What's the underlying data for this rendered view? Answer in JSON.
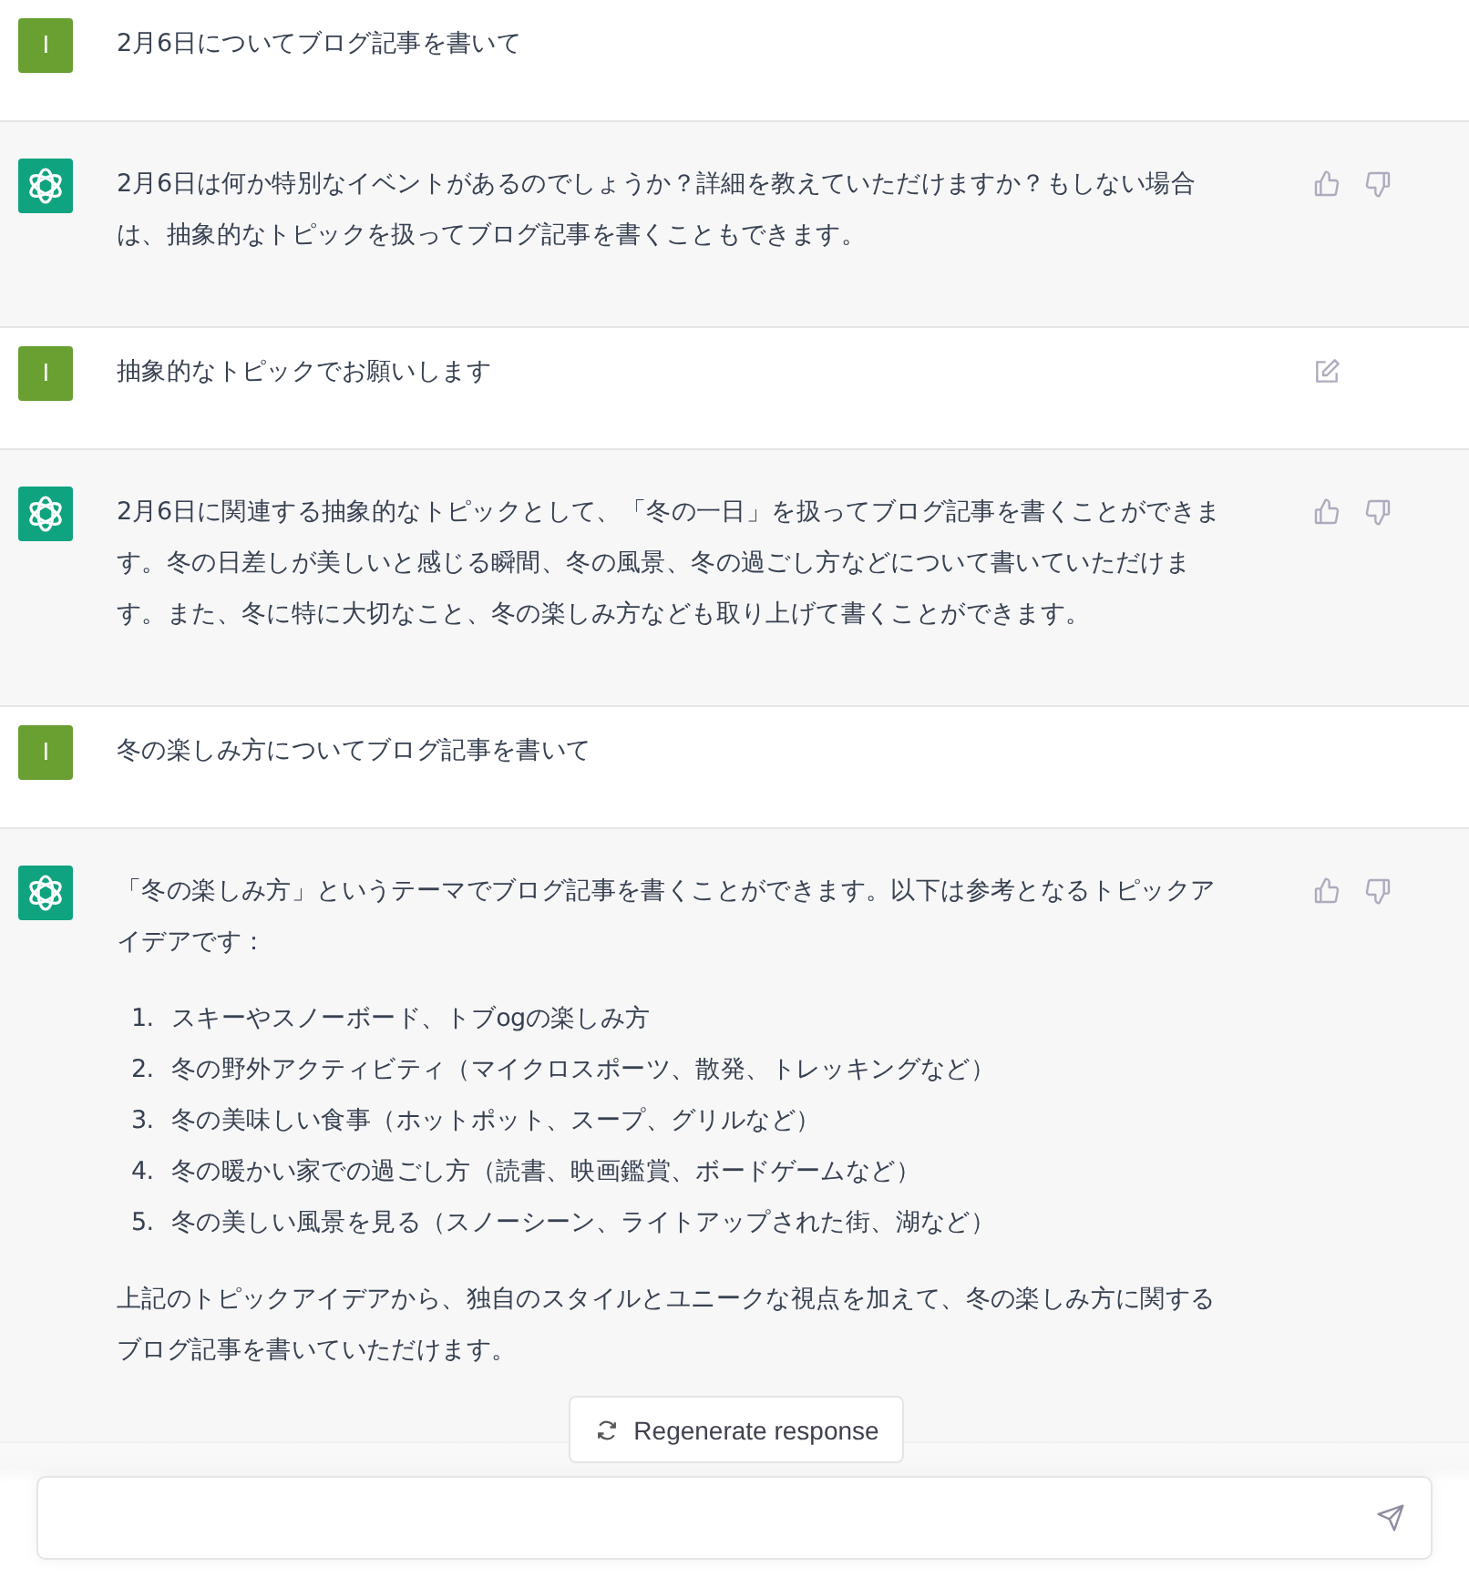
{
  "messages": [
    {
      "kind": "user",
      "avatar": "I",
      "feedback": false,
      "editable": false,
      "blocks": [
        {
          "kind": "paragraph",
          "text": "2月6日についてブログ記事を書いて"
        }
      ]
    },
    {
      "kind": "assistant",
      "feedback": true,
      "editable": false,
      "blocks": [
        {
          "kind": "paragraph",
          "text": "2月6日は何か特別なイベントがあるのでしょうか？詳細を教えていただけますか？もしない場合は、抽象的なトピックを扱ってブログ記事を書くこともできます。"
        }
      ]
    },
    {
      "kind": "user",
      "avatar": "I",
      "feedback": false,
      "editable": true,
      "blocks": [
        {
          "kind": "paragraph",
          "text": "抽象的なトピックでお願いします"
        }
      ]
    },
    {
      "kind": "assistant",
      "feedback": true,
      "editable": false,
      "blocks": [
        {
          "kind": "paragraph",
          "text": "2月6日に関連する抽象的なトピックとして、「冬の一日」を扱ってブログ記事を書くことができます。冬の日差しが美しいと感じる瞬間、冬の風景、冬の過ごし方などについて書いていただけます。また、冬に特に大切なこと、冬の楽しみ方なども取り上げて書くことができます。"
        }
      ]
    },
    {
      "kind": "user",
      "avatar": "I",
      "feedback": false,
      "editable": false,
      "blocks": [
        {
          "kind": "paragraph",
          "text": "冬の楽しみ方についてブログ記事を書いて"
        }
      ]
    },
    {
      "kind": "assistant",
      "feedback": true,
      "editable": false,
      "blocks": [
        {
          "kind": "paragraph",
          "text": "「冬の楽しみ方」というテーマでブログ記事を書くことができます。以下は参考となるトピックアイデアです："
        },
        {
          "kind": "list",
          "items": [
            {
              "number": "1.",
              "text": "スキーやスノーボード、トブogの楽しみ方"
            },
            {
              "number": "2.",
              "text": "冬の野外アクティビティ（マイクロスポーツ、散発、トレッキングなど）"
            },
            {
              "number": "3.",
              "text": "冬の美味しい食事（ホットポット、スープ、グリルなど）"
            },
            {
              "number": "4.",
              "text": "冬の暖かい家での過ごし方（読書、映画鑑賞、ボードゲームなど）"
            },
            {
              "number": "5.",
              "text": "冬の美しい風景を見る（スノーシーン、ライトアップされた街、湖など）"
            }
          ]
        },
        {
          "kind": "paragraph",
          "text": "上記のトピックアイデアから、独自のスタイルとユニークな視点を加えて、冬の楽しみ方に関するブログ記事を書いていただけます。"
        }
      ]
    }
  ],
  "regenerate_button": {
    "label": "Regenerate response"
  }
}
